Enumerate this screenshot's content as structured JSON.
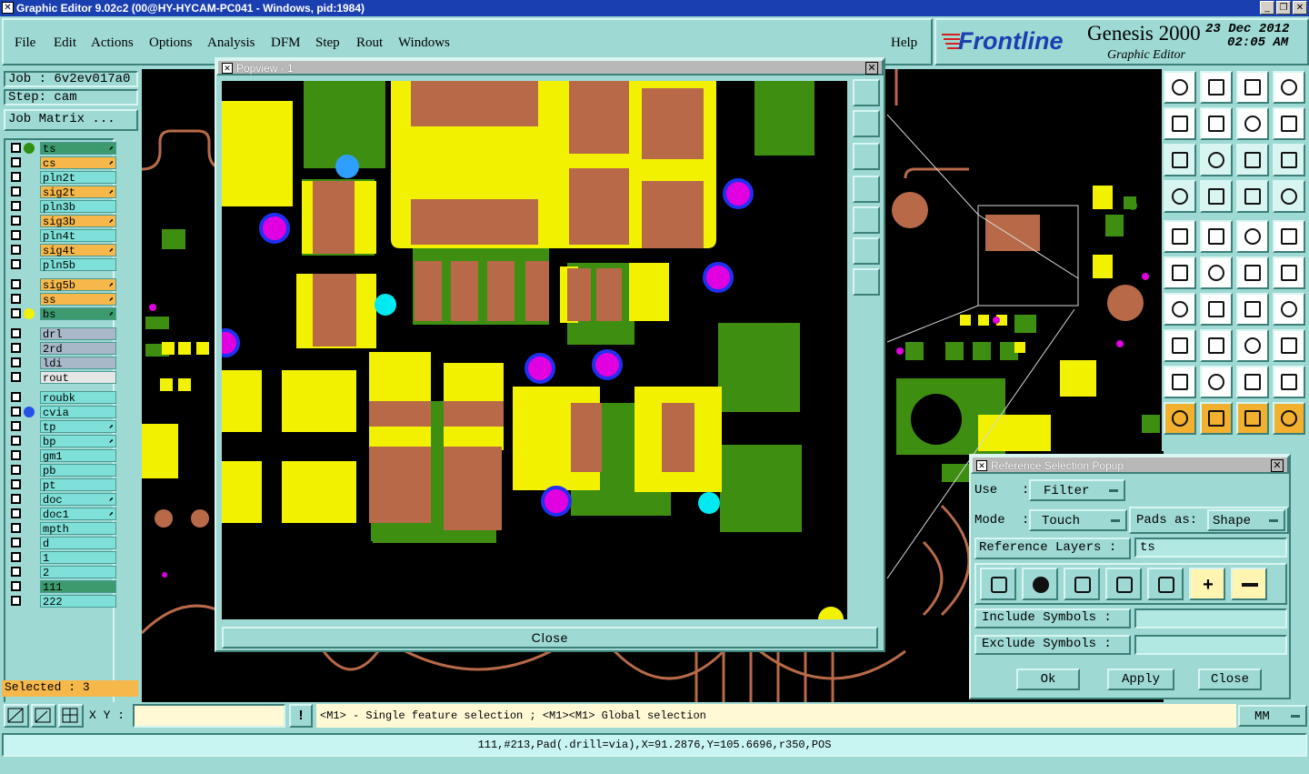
{
  "window": {
    "title": "Graphic Editor 9.02c2 (00@HY-HYCAM-PC041 - Windows, pid:1984)",
    "minimize": "_",
    "restore": "❐",
    "close": "✕"
  },
  "menu": [
    "File",
    "Edit",
    "Actions",
    "Options",
    "Analysis",
    "DFM",
    "Step",
    "Rout",
    "Windows"
  ],
  "help": "Help",
  "brand": {
    "logo": "Frontline",
    "product": "Genesis 2000",
    "subtitle": "Graphic Editor",
    "date": "23 Dec 2012",
    "time": "02:05 AM"
  },
  "job": {
    "job": "Job : 6v2ev017a0",
    "step": "Step: cam",
    "matrix": "Job Matrix ..."
  },
  "layers": [
    {
      "name": "ts",
      "color": "#3c9a6e",
      "dot": "#2f8f11",
      "arrow": true
    },
    {
      "name": "cs",
      "color": "#f6b84b",
      "dot": "",
      "arrow": true
    },
    {
      "name": "pln2t",
      "color": "#7ee0d8",
      "dot": "",
      "arrow": false
    },
    {
      "name": "sig2t",
      "color": "#f6b84b",
      "dot": "",
      "arrow": true
    },
    {
      "name": "pln3b",
      "color": "#7ee0d8",
      "dot": "",
      "arrow": false
    },
    {
      "name": "sig3b",
      "color": "#f6b84b",
      "dot": "",
      "arrow": true
    },
    {
      "name": "pln4t",
      "color": "#7ee0d8",
      "dot": "",
      "arrow": false
    },
    {
      "name": "sig4t",
      "color": "#f6b84b",
      "dot": "",
      "arrow": true
    },
    {
      "name": "pln5b",
      "color": "#7ee0d8",
      "dot": "",
      "arrow": false
    },
    {
      "name": "sig5b",
      "color": "#f6b84b",
      "dot": "",
      "arrow": true
    },
    {
      "name": "ss",
      "color": "#f6b84b",
      "dot": "",
      "arrow": true
    },
    {
      "name": "bs",
      "color": "#3c9a6e",
      "dot": "#f2f200",
      "arrow": true
    },
    {
      "name": "drl",
      "color": "#a8b8c8",
      "dot": "",
      "arrow": false
    },
    {
      "name": "2rd",
      "color": "#a8b8c8",
      "dot": "",
      "arrow": false
    },
    {
      "name": "ldi",
      "color": "#a8b8c8",
      "dot": "",
      "arrow": false
    },
    {
      "name": "rout",
      "color": "#e6e6e6",
      "dot": "",
      "arrow": false
    },
    {
      "name": "roubk",
      "color": "#7ee0d8",
      "dot": "",
      "arrow": false
    },
    {
      "name": "cvia",
      "color": "#7ee0d8",
      "dot": "#2450e6",
      "arrow": false
    },
    {
      "name": "tp",
      "color": "#7ee0d8",
      "dot": "",
      "arrow": true
    },
    {
      "name": "bp",
      "color": "#7ee0d8",
      "dot": "",
      "arrow": true
    },
    {
      "name": "gm1",
      "color": "#7ee0d8",
      "dot": "",
      "arrow": false
    },
    {
      "name": "pb",
      "color": "#7ee0d8",
      "dot": "",
      "arrow": false
    },
    {
      "name": "pt",
      "color": "#7ee0d8",
      "dot": "",
      "arrow": false
    },
    {
      "name": "doc",
      "color": "#7ee0d8",
      "dot": "",
      "arrow": true
    },
    {
      "name": "doc1",
      "color": "#7ee0d8",
      "dot": "",
      "arrow": true
    },
    {
      "name": "mpth",
      "color": "#7ee0d8",
      "dot": "",
      "arrow": false
    },
    {
      "name": "d",
      "color": "#7ee0d8",
      "dot": "",
      "arrow": false
    },
    {
      "name": "1",
      "color": "#7ee0d8",
      "dot": "",
      "arrow": false
    },
    {
      "name": "2",
      "color": "#7ee0d8",
      "dot": "",
      "arrow": false
    },
    {
      "name": "111",
      "color": "#3c9a6e",
      "dot": "",
      "arrow": false
    },
    {
      "name": "222",
      "color": "#7ee0d8",
      "dot": "",
      "arrow": false
    }
  ],
  "selected": "Selected : 3",
  "popview": {
    "title": "Popview - 1",
    "close": "Close"
  },
  "refpopup": {
    "title": "Reference Selection Popup",
    "use_label": "Use",
    "use_value": "Filter",
    "mode_label": "Mode",
    "mode_value": "Touch",
    "pads_label": "Pads as:",
    "pads_value": "Shape",
    "ref_layers_label": "Reference Layers :",
    "ref_layers_value": "ts",
    "include_label": "Include Symbols :",
    "include_value": "",
    "exclude_label": "Exclude Symbols :",
    "exclude_value": "",
    "ok": "Ok",
    "apply": "Apply",
    "close": "Close"
  },
  "bottom": {
    "xy_label": "X Y :",
    "xy_value": "",
    "hint": "<M1> - Single feature selection ; <M1><M1> Global selection",
    "units": "MM"
  },
  "status": "111,#213,Pad(.drill=via),X=91.2876,Y=105.6696,r350,POS"
}
